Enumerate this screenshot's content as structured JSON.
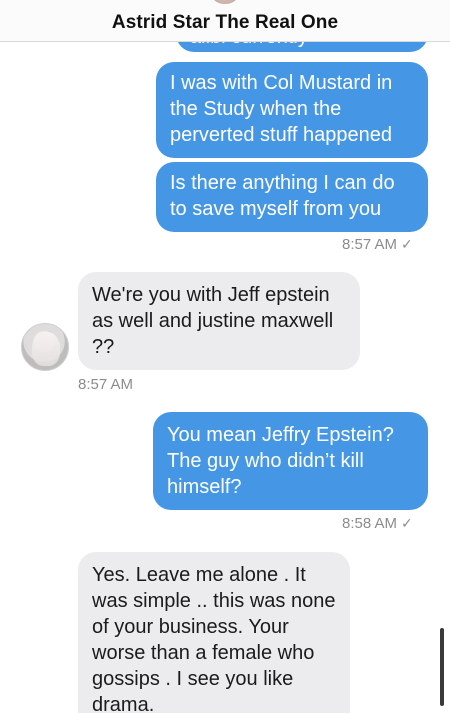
{
  "header": {
    "title": "Astrid Star The Real One"
  },
  "messages": [
    {
      "side": "out",
      "text": "alibi currently"
    },
    {
      "side": "out",
      "text": "I was with Col Mustard in the Study when the perverted stuff happened"
    },
    {
      "side": "out",
      "text": "Is there anything I can do to save myself from you"
    },
    {
      "side": "in",
      "text": "We're you with Jeff epstein as well and justine maxwell ??"
    },
    {
      "side": "out",
      "text": "You mean Jeffry Epstein? The guy who didn’t kill himself?"
    },
    {
      "side": "in",
      "text": "Yes. Leave me alone . It was simple .. this was none of your business. Your worse than a female who gossips . I see you like drama."
    }
  ],
  "timestamps": {
    "t1": "8:57 AM",
    "t2": "8:57 AM",
    "t3": "8:58 AM"
  },
  "read_receipt_icon": "✓",
  "colors": {
    "outgoing_bubble": "#4597e5",
    "incoming_bubble": "#ececee",
    "timestamp": "#8c8c8f"
  }
}
